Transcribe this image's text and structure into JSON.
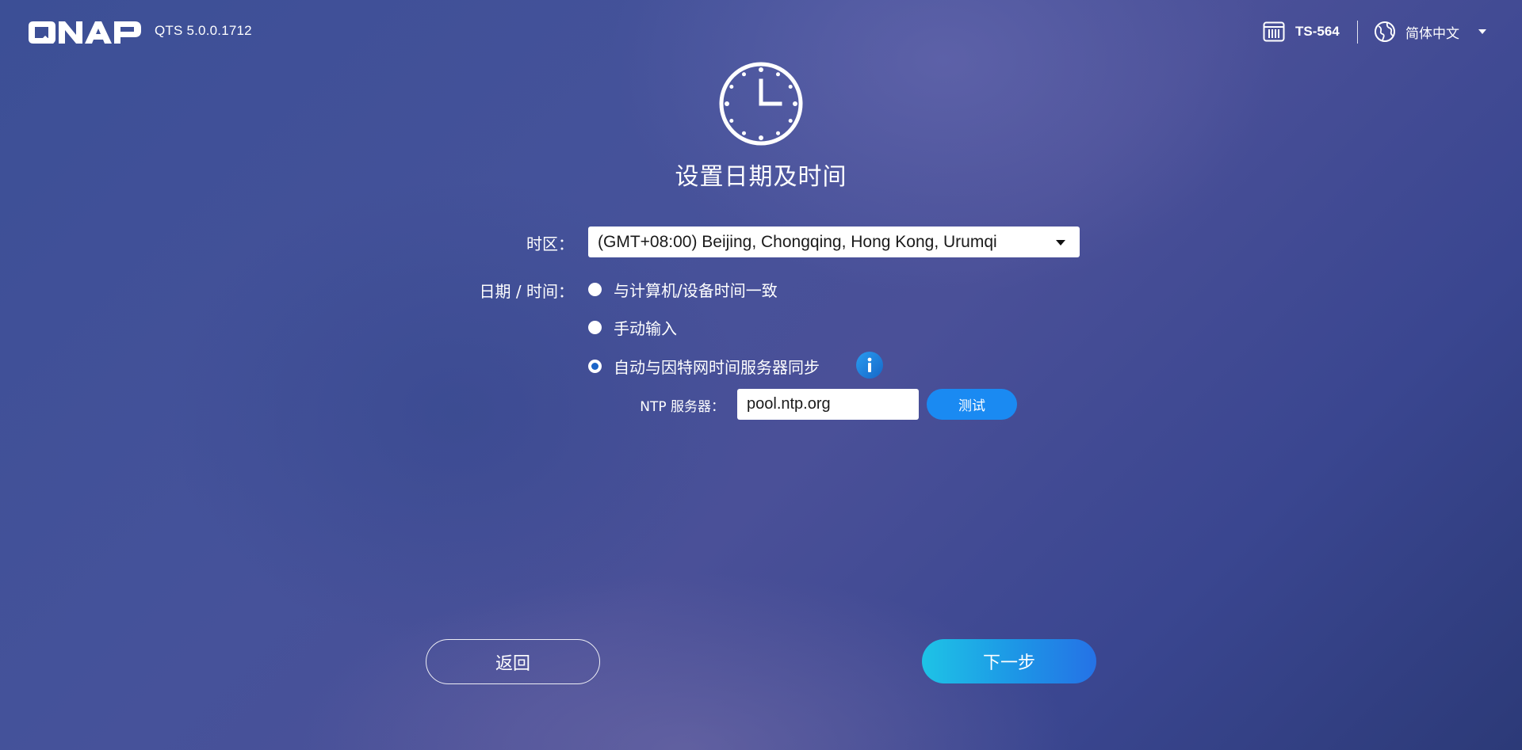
{
  "header": {
    "brand": "QNAP",
    "version": "QTS 5.0.0.1712",
    "device_icon": "nas-device-icon",
    "device_name": "TS-564",
    "language_icon": "globe-icon",
    "language": "简体中文"
  },
  "hero": {
    "icon": "clock-icon",
    "title": "设置日期及时间"
  },
  "form": {
    "timezone_label": "时区：",
    "timezone_value": "(GMT+08:00) Beijing, Chongqing, Hong Kong, Urumqi",
    "datetime_label": "日期 / 时间：",
    "options": [
      {
        "label": "与计算机/设备时间一致",
        "checked": false
      },
      {
        "label": "手动输入",
        "checked": false
      },
      {
        "label": "自动与因特网时间服务器同步",
        "checked": true
      }
    ],
    "info_icon": "info-icon",
    "ntp_label": "NTP 服务器：",
    "ntp_value": "pool.ntp.org",
    "test_button": "测试"
  },
  "footer": {
    "back_button": "返回",
    "next_button": "下一步"
  },
  "colors": {
    "background": "#3c4f96",
    "accent": "#1a8af2",
    "next_gradient_start": "#1ec3e6",
    "next_gradient_end": "#2572e6"
  }
}
